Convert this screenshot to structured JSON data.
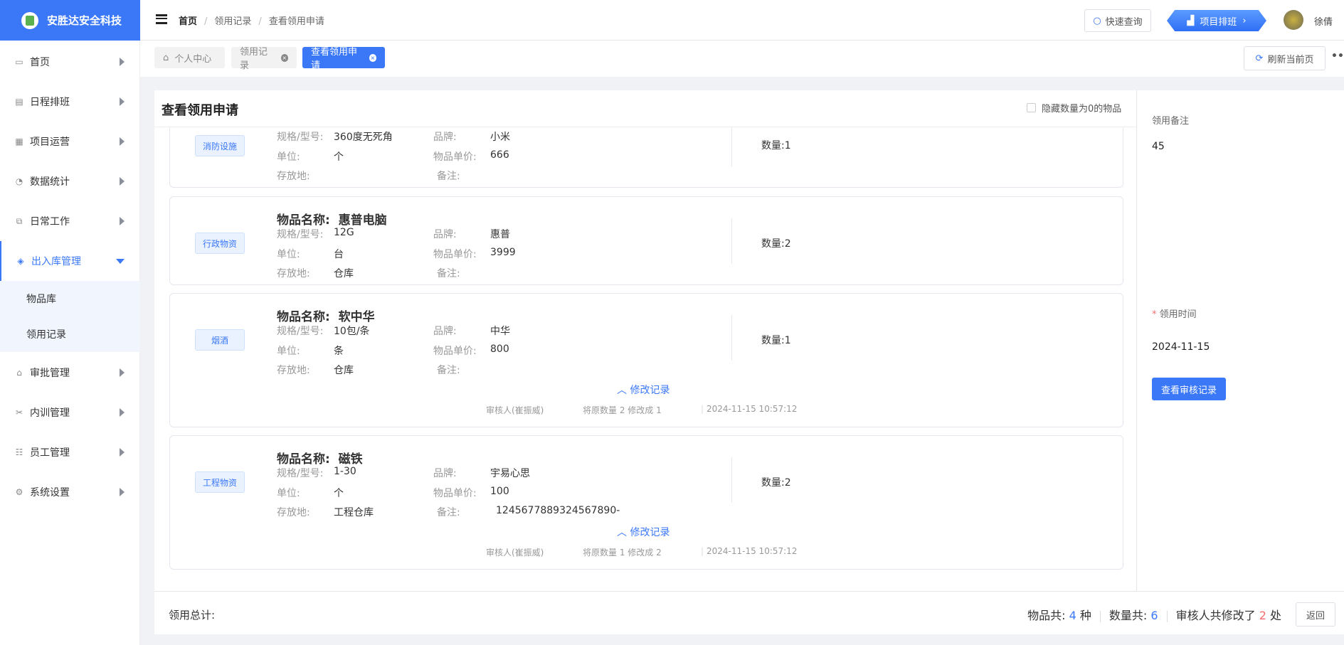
{
  "app": {
    "name": "安胜达安全科技"
  },
  "sidebar": {
    "items": [
      {
        "label": "首页",
        "icon": "monitor-icon",
        "glyph": "▭"
      },
      {
        "label": "日程排班",
        "icon": "calendar-icon",
        "glyph": "▤"
      },
      {
        "label": "项目运营",
        "icon": "grid-icon",
        "glyph": "▦"
      },
      {
        "label": "数据统计",
        "icon": "pie-chart-icon",
        "glyph": "◔"
      },
      {
        "label": "日常工作",
        "icon": "copy-icon",
        "glyph": "⧉"
      },
      {
        "label": "出入库管理",
        "icon": "layers-icon",
        "glyph": "◈",
        "open": true
      },
      {
        "label": "审批管理",
        "icon": "lock-icon",
        "glyph": "⌂"
      },
      {
        "label": "内训管理",
        "icon": "tools-icon",
        "glyph": "✂"
      },
      {
        "label": "员工管理",
        "icon": "list-icon",
        "glyph": "☷"
      },
      {
        "label": "系统设置",
        "icon": "gear-icon",
        "glyph": "⚙"
      }
    ],
    "submenu": [
      "物品库",
      "领用记录"
    ]
  },
  "header": {
    "breadcrumb": [
      "首页",
      "领用记录",
      "查看领用申请"
    ],
    "quick_search": "快速查询",
    "project_button": "项目排班",
    "user": "徐倩"
  },
  "tabs": [
    {
      "label": "个人中心"
    },
    {
      "label": "领用记录"
    },
    {
      "label": "查看领用申请"
    }
  ],
  "refresh_label": "刷新当前页",
  "panel": {
    "title": "查看领用申请",
    "hide_zero_label": "隐藏数量为0的物品",
    "hide_zero_checked": false
  },
  "labels": {
    "name": "物品名称:",
    "spec": "规格/型号:",
    "unit": "单位:",
    "storage": "存放地:",
    "brand": "品牌:",
    "price": "物品单价:",
    "remark": "备注:",
    "qty": "数量:",
    "records": "修改记录"
  },
  "items": [
    {
      "category": "消防设施",
      "name": "",
      "spec": "360度无死角",
      "unit": "个",
      "storage": "",
      "brand": "小米",
      "price": "666",
      "remark": "",
      "qty": "1",
      "records": []
    },
    {
      "category": "行政物资",
      "name": "惠普电脑",
      "spec": "12G",
      "unit": "台",
      "storage": "仓库",
      "brand": "惠普",
      "price": "3999",
      "remark": "",
      "qty": "2",
      "records": []
    },
    {
      "category": "烟酒",
      "name": "软中华",
      "spec": "10包/条",
      "unit": "条",
      "storage": "仓库",
      "brand": "中华",
      "price": "800",
      "remark": "",
      "qty": "1",
      "records": [
        {
          "auditor": "审核人(崔振威)",
          "change": "将原数量 2 修改成 1",
          "time": "2024-11-15 10:57:12"
        }
      ]
    },
    {
      "category": "工程物资",
      "name": "磁铁",
      "spec": "1-30",
      "unit": "个",
      "storage": "工程仓库",
      "brand": "宇易心思",
      "price": "100",
      "remark": "1245677889324567890-",
      "qty": "2",
      "records": [
        {
          "auditor": "审核人(崔振威)",
          "change": "将原数量 1 修改成 2",
          "time": "2024-11-15 10:57:12"
        }
      ]
    }
  ],
  "right": {
    "remark_label": "领用备注",
    "remark_value": "45",
    "time_label": "领用时间",
    "required_mark": "*",
    "time_value": "2024-11-15",
    "audit_button": "查看审核记录"
  },
  "footer": {
    "total_label": "领用总计:",
    "items_prefix": "物品共:",
    "items_count": "4",
    "items_suffix": "种",
    "qty_prefix": "数量共:",
    "qty_count": "6",
    "mod_prefix": "审核人共修改了",
    "mod_count": "2",
    "mod_suffix": "处",
    "back_button": "返回"
  },
  "colors": {
    "primary": "#3a78f8",
    "danger": "#f56c6c"
  }
}
